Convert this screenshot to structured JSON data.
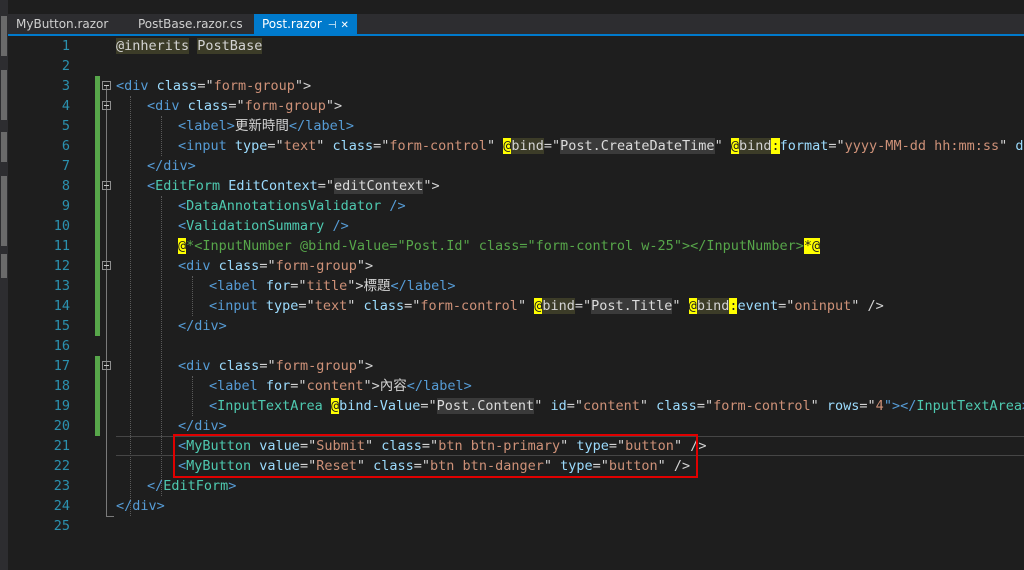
{
  "tabs": [
    {
      "label": "MyButton.razor"
    },
    {
      "label": "PostBase.razor.cs"
    },
    {
      "label": "Post.razor",
      "active": true
    }
  ],
  "tab_pin_glyph": "⊣",
  "tab_close_glyph": "✕",
  "line_numbers": [
    "1",
    "2",
    "3",
    "4",
    "5",
    "6",
    "7",
    "8",
    "9",
    "10",
    "11",
    "12",
    "13",
    "14",
    "15",
    "16",
    "17",
    "18",
    "19",
    "20",
    "21",
    "22",
    "23",
    "24",
    "25"
  ],
  "code": {
    "l1": {
      "p1": "@inherits",
      "p2": " ",
      "p3": "PostBase"
    },
    "l3": {
      "p1": "<",
      "p2": "div",
      "p3": " class",
      "p4": "=\"",
      "p5": "form-group",
      "p6": "\">"
    },
    "l4": {
      "p1": "<",
      "p2": "div",
      "p3": " class",
      "p4": "=\"",
      "p5": "form-group",
      "p6": "\">"
    },
    "l5": {
      "p1": "<",
      "p2": "label",
      "p3": ">",
      "p4": "更新時間",
      "p5": "</",
      "p6": "label",
      "p7": ">"
    },
    "l6": {
      "p1": "<",
      "p2": "input",
      "p3": " type",
      "p4": "=\"",
      "p5": "text",
      "p6": "\"",
      "p7": " class",
      "p8": "=\"",
      "p9": "form-control",
      "p10": "\" ",
      "p11": "@",
      "p12": "bind",
      "p13": "=\"",
      "p14": "Post.CreateDateTime",
      "p15": "\" ",
      "p16": "@",
      "p17": "bind",
      "p18": ":",
      "p19": "format",
      "p20": "=\"",
      "p21": "yyyy-MM-dd hh:mm:ss",
      "p22": "\" ",
      "p23": "disabl"
    },
    "l7": {
      "p1": "</",
      "p2": "div",
      "p3": ">"
    },
    "l8": {
      "p1": "<",
      "p2": "EditForm",
      "p3": " EditContext",
      "p4": "=\"",
      "p5": "editContext",
      "p6": "\">"
    },
    "l9": {
      "p1": "<",
      "p2": "DataAnnotationsValidator",
      "p3": " />"
    },
    "l10": {
      "p1": "<",
      "p2": "ValidationSummary",
      "p3": " />"
    },
    "l11": {
      "p1": "@",
      "p2": "*",
      "p3": "<InputNumber @bind-Value=\"Post.Id\" class=\"form-control w-25\"></InputNumber>",
      "p4": "*@"
    },
    "l12": {
      "p1": "<",
      "p2": "div",
      "p3": " class",
      "p4": "=\"",
      "p5": "form-group",
      "p6": "\">"
    },
    "l13": {
      "p1": "<",
      "p2": "label",
      "p3": " for",
      "p4": "=\"",
      "p5": "title",
      "p6": "\">",
      "p7": "標題",
      "p8": "</",
      "p9": "label",
      "p10": ">"
    },
    "l14": {
      "p1": "<",
      "p2": "input",
      "p3": " type",
      "p4": "=\"",
      "p5": "text",
      "p6": "\"",
      "p7": " class",
      "p8": "=\"",
      "p9": "form-control",
      "p10": "\" ",
      "p11": "@",
      "p12": "bind",
      "p13": "=\"",
      "p14": "Post.Title",
      "p15": "\" ",
      "p16": "@",
      "p17": "bind",
      "p18": ":",
      "p19": "event",
      "p20": "=\"",
      "p21": "oninput",
      "p22": "\" />"
    },
    "l15": {
      "p1": "</",
      "p2": "div",
      "p3": ">"
    },
    "l17": {
      "p1": "<",
      "p2": "div",
      "p3": " class",
      "p4": "=\"",
      "p5": "form-group",
      "p6": "\">"
    },
    "l18": {
      "p1": "<",
      "p2": "label",
      "p3": " for",
      "p4": "=\"",
      "p5": "content",
      "p6": "\">",
      "p7": "內容",
      "p8": "</",
      "p9": "label",
      "p10": ">"
    },
    "l19": {
      "p1": "<",
      "p2": "InputTextArea",
      "p3": " ",
      "p4": "@",
      "p5": "bind-Value",
      "p6": "=\"",
      "p7": "Post.Content",
      "p8": "\"",
      "p9": " id",
      "p10": "=\"",
      "p11": "content",
      "p12": "\"",
      "p13": " class",
      "p14": "=\"",
      "p15": "form-control",
      "p16": "\"",
      "p17": " rows",
      "p18": "=\"",
      "p19": "4",
      "p20": "\"></",
      "p21": "InputTextArea",
      "p22": ">"
    },
    "l20": {
      "p1": "</",
      "p2": "div",
      "p3": ">"
    },
    "l21": {
      "p1": "<",
      "p2": "MyButton",
      "p3": " value",
      "p4": "=\"",
      "p5": "Submit",
      "p6": "\"",
      "p7": " class",
      "p8": "=\"",
      "p9": "btn btn-primary",
      "p10": "\"",
      "p11": " type",
      "p12": "=\"",
      "p13": "button",
      "p14": "\" />"
    },
    "l22": {
      "p1": "<",
      "p2": "MyButton",
      "p3": " value",
      "p4": "=\"",
      "p5": "Reset",
      "p6": "\"",
      "p7": " class",
      "p8": "=\"",
      "p9": "btn btn-danger",
      "p10": "\"",
      "p11": " type",
      "p12": "=\"",
      "p13": "button",
      "p14": "\" />"
    },
    "l23": {
      "p1": "</",
      "p2": "EditForm",
      "p3": ">"
    },
    "l24": {
      "p1": "</",
      "p2": "div",
      "p3": ">"
    }
  },
  "colors": {
    "background": "#1e1e1e",
    "tab_active": "#007acc",
    "line_number": "#2b91af",
    "tag": "#569cd6",
    "attribute": "#9cdcfe",
    "string": "#ce9178",
    "component": "#4ec9b0",
    "razor_transition": "#ffff00",
    "change_marker": "#57a64a",
    "highlight_box": "#e00000"
  }
}
